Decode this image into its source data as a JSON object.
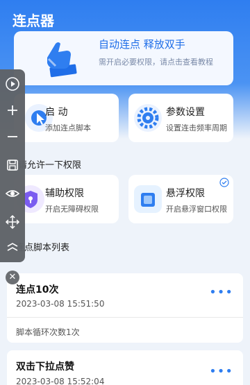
{
  "header": {
    "title": "连点器"
  },
  "banner": {
    "title": "自动连点 释放双手",
    "subtitle": "需开启必要权限，请点击查看教程"
  },
  "actions": [
    {
      "title": "启 动",
      "subtitle": "添加连点脚本",
      "icon": "cursor-click-icon"
    },
    {
      "title": "参数设置",
      "subtitle": "设置连击频率周期",
      "icon": "gear-icon"
    }
  ],
  "permissions": {
    "section_title": "请允许一下权限",
    "items": [
      {
        "title": "辅助权限",
        "subtitle": "开启无障碍权限",
        "icon": "shield-icon"
      },
      {
        "title": "悬浮权限",
        "subtitle": "开启悬浮窗口权限",
        "icon": "floating-window-icon",
        "granted": true
      }
    ]
  },
  "scripts": {
    "section_title": "连点脚本列表",
    "items": [
      {
        "title": "连点10次",
        "time": "2023-03-08 15:51:50",
        "footer": "脚本循环次数1次"
      },
      {
        "title": "双击下拉点赞",
        "time": "2023-03-08 15:52:04"
      }
    ]
  },
  "floating_toolbar": [
    "play-icon",
    "plus-icon",
    "minus-icon",
    "save-icon",
    "eye-icon",
    "move-icon",
    "collapse-icon"
  ],
  "colors": {
    "primary": "#2f7ef0",
    "toolbar": "#5f6368",
    "background": "#eef3fa"
  }
}
